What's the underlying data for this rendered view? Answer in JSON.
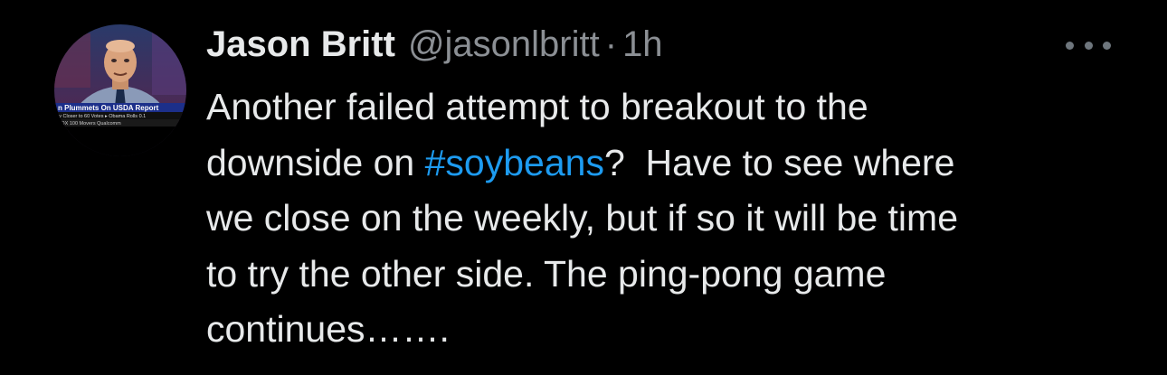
{
  "tweet": {
    "author": {
      "name": "Jason Britt",
      "handle": "@jasonlbritt"
    },
    "separator": "·",
    "time": "1h",
    "more_icon": "more-horizontal-icon",
    "text_lines": {
      "l1": "Another failed attempt to breakout to the",
      "l2_before": "downside on ",
      "hashtag": "#soybeans",
      "l2_after": "?  Have to see where",
      "l3": "we close on the weekly, but if so it will be time",
      "l4": "to try the other side. The ping-pong game",
      "l5": "continues……."
    },
    "avatar": {
      "ticker_banner": "n Plummets On USDA Report",
      "ticker_line1": "ly Closer to 60 Votes  ▸ Obama Rolls 0.1",
      "ticker_line2": "SDX 100 Movers   Qualcomm"
    }
  },
  "colors": {
    "background": "#000000",
    "text": "#e7e9ea",
    "muted": "#8b8f94",
    "hashtag": "#1d9bf0"
  }
}
